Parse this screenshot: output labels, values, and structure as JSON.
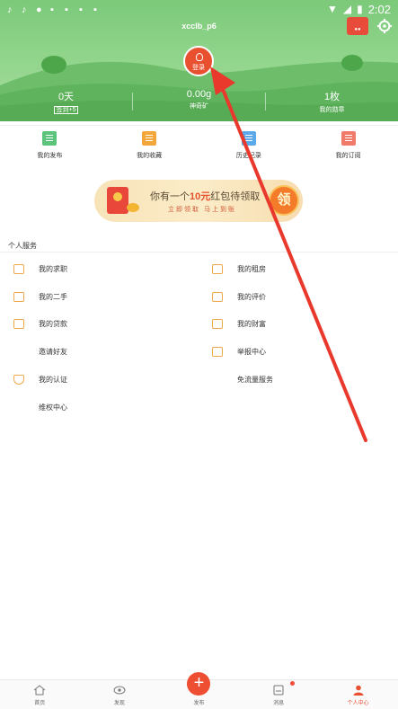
{
  "status_bar": {
    "time": "2:02",
    "icons": [
      "tiktok-icon",
      "tiktok-icon",
      "chrome-icon",
      "app-icon",
      "app-icon",
      "app-icon",
      "app-icon"
    ]
  },
  "header": {
    "username": "xcclb_p6",
    "checkin_label": "",
    "login_label": "登录",
    "stats": [
      {
        "value": "0天",
        "label": "签到+5"
      },
      {
        "value": "0.00g",
        "label": "神奇矿"
      },
      {
        "value": "1枚",
        "label": "我的勋章"
      }
    ]
  },
  "quick_menu": [
    {
      "label": "我的发布",
      "icon": "document-icon",
      "color": "#5cc47a"
    },
    {
      "label": "我的收藏",
      "icon": "star-folder-icon",
      "color": "#f3a73a"
    },
    {
      "label": "历史记录",
      "icon": "history-icon",
      "color": "#5ba9e8"
    },
    {
      "label": "我的订阅",
      "icon": "subscribe-icon",
      "color": "#f07b6b"
    }
  ],
  "banner": {
    "title_prefix": "你有一个",
    "title_amount": "10元",
    "title_suffix": "红包待领取",
    "subtitle": "立即领取 马上到账",
    "claim_label": "领"
  },
  "services": {
    "title": "个人服务",
    "left": [
      {
        "label": "我的求职",
        "icon": "briefcase-icon"
      },
      {
        "label": "我的二手",
        "icon": "secondhand-icon"
      },
      {
        "label": "我的贷款",
        "icon": "wallet-icon"
      },
      {
        "label": "邀请好友",
        "icon": ""
      },
      {
        "label": "我的认证",
        "icon": "shield-icon"
      },
      {
        "label": "维权中心",
        "icon": ""
      }
    ],
    "right": [
      {
        "label": "我的租房",
        "icon": "building-icon"
      },
      {
        "label": "我的评价",
        "icon": "calendar-icon"
      },
      {
        "label": "我的财富",
        "icon": "wealth-icon"
      },
      {
        "label": "举报中心",
        "icon": "report-icon"
      },
      {
        "label": "免流量服务",
        "icon": ""
      }
    ]
  },
  "bottom_nav": [
    {
      "label": "首页",
      "icon": "home-icon"
    },
    {
      "label": "发现",
      "icon": "eye-icon"
    },
    {
      "label": "发布",
      "icon": "plus-icon"
    },
    {
      "label": "消息",
      "icon": "message-icon"
    },
    {
      "label": "个人中心",
      "icon": "person-icon",
      "active": true
    }
  ],
  "colors": {
    "accent": "#e9502f",
    "header_green": "#8fd48a",
    "service_icon": "#f0a94a"
  }
}
